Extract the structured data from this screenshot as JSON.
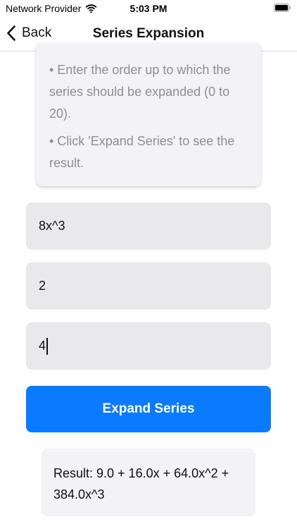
{
  "status_bar": {
    "carrier": "Network Provider",
    "time": "5:03 PM"
  },
  "nav": {
    "back_label": "Back",
    "title": "Series Expansion"
  },
  "instructions": {
    "line_order": "• Enter the order up to which the series should be expanded (0 to 20).",
    "line_click": "• Click 'Expand Series' to see the result."
  },
  "inputs": {
    "function_value": "8x^3",
    "point_value": "2",
    "order_value": "4"
  },
  "expand_button_label": "Expand Series",
  "result_text": "Result: 9.0 + 16.0x + 64.0x^2 + 384.0x^3"
}
